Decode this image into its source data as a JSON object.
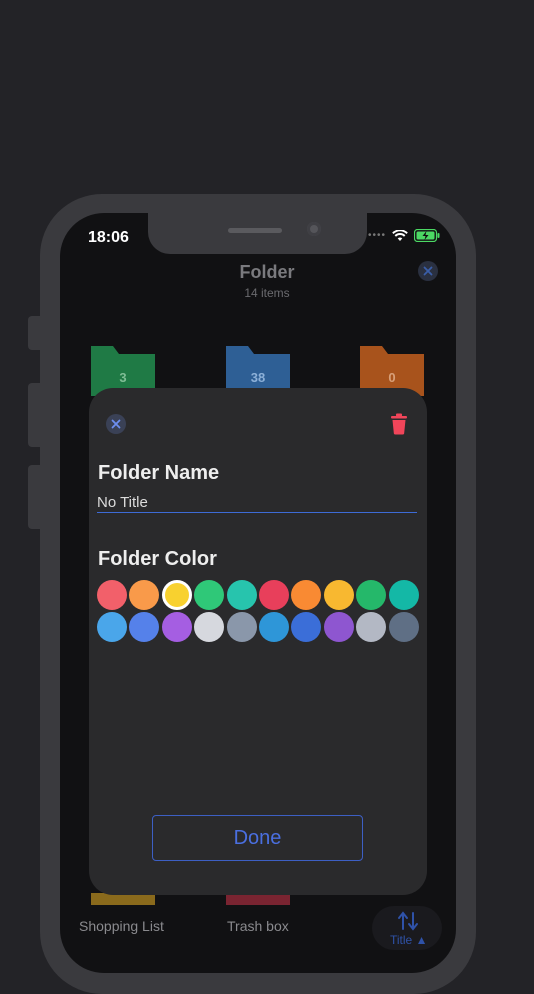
{
  "status_bar": {
    "time": "18:06",
    "dots": "•••• "
  },
  "header": {
    "title": "Folder",
    "subtitle": "14 items"
  },
  "folders_top": [
    {
      "count": "3",
      "color": "#1f7a45"
    },
    {
      "count": "38",
      "color": "#2e5f95"
    },
    {
      "count": "0",
      "color": "#a8531c"
    }
  ],
  "bottom_bar": {
    "shopping_list": "Shopping List",
    "trash_box": "Trash box",
    "sort_label": "Title"
  },
  "modal": {
    "name_heading": "Folder Name",
    "name_value": "No Title",
    "color_heading": "Folder Color",
    "done_label": "Done",
    "selected_color_index": 2,
    "colors": [
      "#f2606a",
      "#f99a4a",
      "#f8d12f",
      "#2fc878",
      "#27c4ad",
      "#e83f5b",
      "#f98a33",
      "#f8b830",
      "#25b86a",
      "#14b8a6",
      "#4aa6ea",
      "#5581ea",
      "#a55ee2",
      "#d6d8de",
      "#8a97aa",
      "#2e96d8",
      "#3b6ed8",
      "#8e56d0",
      "#b3b8c4",
      "#5f6f85"
    ]
  }
}
